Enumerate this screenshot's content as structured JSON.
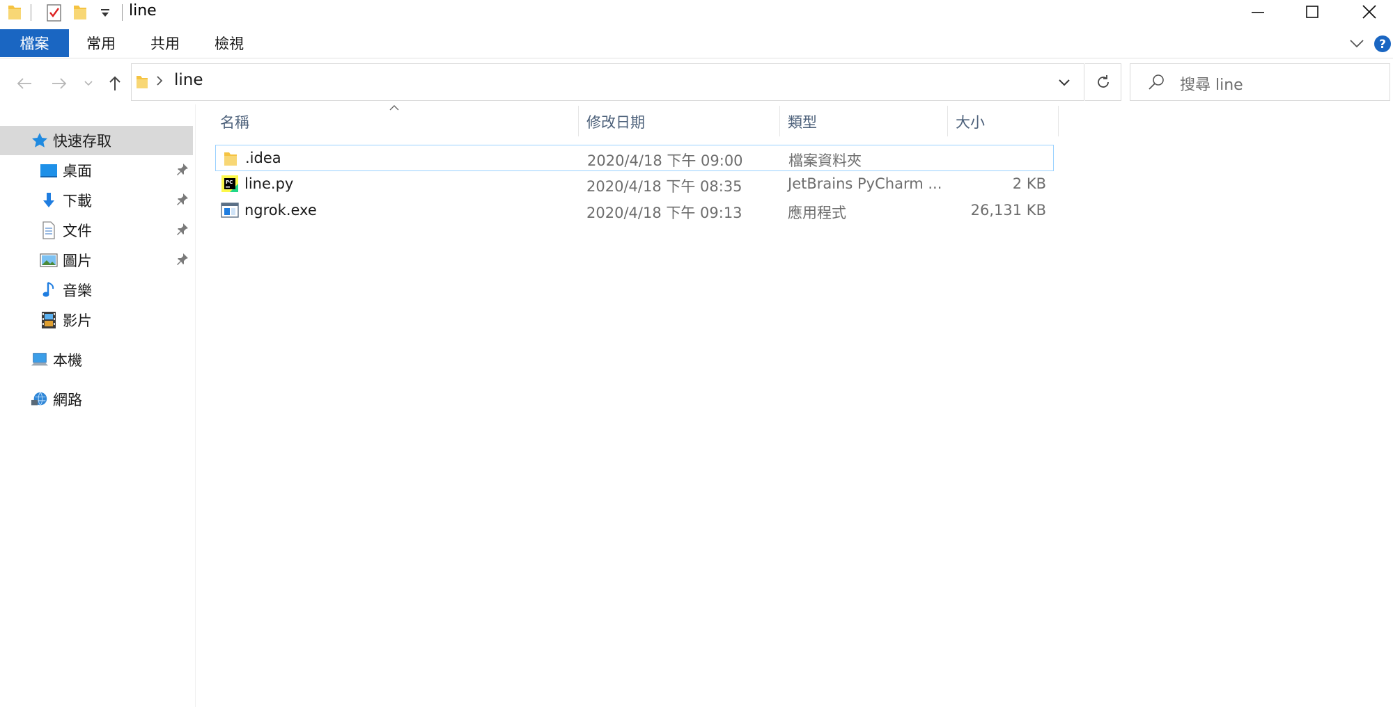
{
  "window": {
    "title": "line",
    "controls": [
      "minimize-icon",
      "maximize-icon",
      "close-icon"
    ]
  },
  "ribbon": {
    "file_tab": "檔案",
    "tabs": [
      "常用",
      "共用",
      "檢視"
    ]
  },
  "address": {
    "path": "line",
    "search_placeholder": "搜尋 line"
  },
  "sidebar": {
    "quick_access": "快速存取",
    "items": [
      {
        "label": "桌面",
        "icon": "desktop-icon",
        "pinned": true
      },
      {
        "label": "下載",
        "icon": "download-icon",
        "pinned": true
      },
      {
        "label": "文件",
        "icon": "document-icon",
        "pinned": true
      },
      {
        "label": "圖片",
        "icon": "pictures-icon",
        "pinned": true
      },
      {
        "label": "音樂",
        "icon": "music-icon",
        "pinned": false
      },
      {
        "label": "影片",
        "icon": "video-icon",
        "pinned": false
      }
    ],
    "this_pc": "本機",
    "network": "網路"
  },
  "file_list": {
    "columns": [
      "名稱",
      "修改日期",
      "類型",
      "大小"
    ],
    "rows": [
      {
        "name": ".idea",
        "date": "2020/4/18 下午 09:00",
        "type": "檔案資料夾",
        "size": "",
        "icon": "folder-icon"
      },
      {
        "name": "line.py",
        "date": "2020/4/18 下午 08:35",
        "type": "JetBrains PyCharm ...",
        "size": "2 KB",
        "icon": "pycharm-file-icon"
      },
      {
        "name": "ngrok.exe",
        "date": "2020/4/18 下午 09:13",
        "type": "應用程式",
        "size": "26,131 KB",
        "icon": "application-icon"
      }
    ]
  },
  "colors": {
    "accent": "#1a66c2",
    "selection_border": "#99d1ff",
    "nav_selected": "#d9d9d9",
    "folder": "#f5c342"
  }
}
